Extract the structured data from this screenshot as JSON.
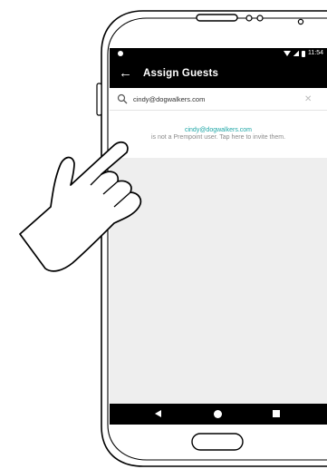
{
  "app_bar": {
    "title": "Assign Guests",
    "back_icon": "arrow-left-icon"
  },
  "status_bar": {
    "time": "11:54",
    "icons": [
      "signal-dot-icon",
      "wifi-icon",
      "cell-signal-icon",
      "battery-icon"
    ]
  },
  "search": {
    "value": "cindy@dogwalkers.com",
    "clear_icon": "close-icon"
  },
  "invite": {
    "email": "cindy@dogwalkers.com",
    "message": "is not a Prempoint user. Tap here to invite them."
  },
  "nav": {
    "icons": [
      "back-triangle-icon",
      "home-circle-icon",
      "recents-square-icon"
    ]
  },
  "colors": {
    "accent": "#1ea6a6",
    "app_bar": "#000000",
    "content_bg": "#eeeeee"
  }
}
